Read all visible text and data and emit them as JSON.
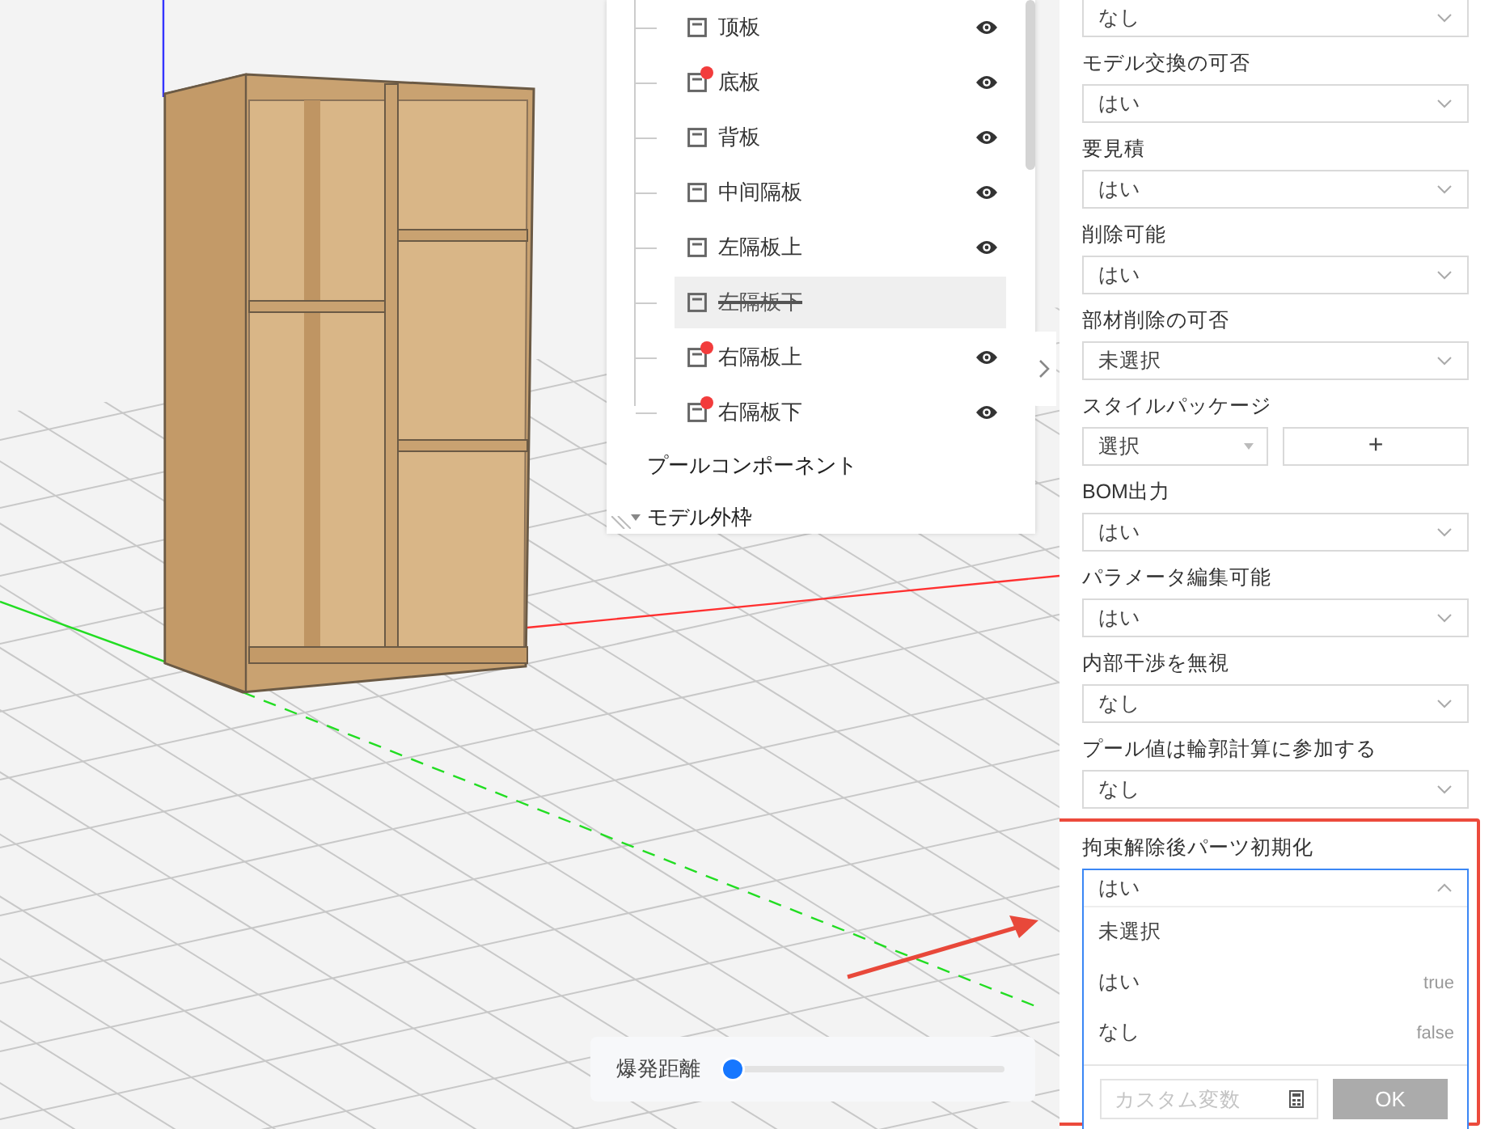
{
  "tree": {
    "items": [
      {
        "label": "顶板",
        "warning": false,
        "hidden": false,
        "selected": false
      },
      {
        "label": "底板",
        "warning": true,
        "hidden": false,
        "selected": false
      },
      {
        "label": "背板",
        "warning": false,
        "hidden": false,
        "selected": false
      },
      {
        "label": "中间隔板",
        "warning": false,
        "hidden": false,
        "selected": false
      },
      {
        "label": "左隔板上",
        "warning": false,
        "hidden": false,
        "selected": false
      },
      {
        "label": "左隔板下",
        "warning": false,
        "hidden": true,
        "selected": true
      },
      {
        "label": "右隔板上",
        "warning": true,
        "hidden": false,
        "selected": false
      },
      {
        "label": "右隔板下",
        "warning": true,
        "hidden": false,
        "selected": false
      }
    ],
    "groups": [
      {
        "label": "プールコンポーネント",
        "kind": "leaf"
      },
      {
        "label": "モデル外枠",
        "kind": "folder",
        "expanded": true
      }
    ]
  },
  "slider": {
    "label": "爆発距離",
    "level": 0
  },
  "properties": {
    "fields": [
      {
        "kind": "select",
        "value": "なし"
      },
      {
        "kind": "select",
        "label": "モデル交換の可否",
        "value": "はい"
      },
      {
        "kind": "select",
        "label": "要見積",
        "value": "はい"
      },
      {
        "kind": "select",
        "label": "削除可能",
        "value": "はい"
      },
      {
        "kind": "select",
        "label": "部材削除の可否",
        "value": "未選択"
      },
      {
        "kind": "select-add",
        "label": "スタイルパッケージ",
        "value": "選択",
        "button": "+"
      },
      {
        "kind": "select",
        "label": "BOM出力",
        "value": "はい"
      },
      {
        "kind": "select",
        "label": "パラメータ編集可能",
        "value": "はい"
      },
      {
        "kind": "select",
        "label": "内部干渉を無視",
        "value": "なし"
      },
      {
        "kind": "select",
        "label": "プール値は輪郭計算に参加する",
        "value": "なし"
      },
      {
        "kind": "dropdown-open",
        "label": "拘束解除後パーツ初期化",
        "value": "はい",
        "highlighted": true,
        "options": [
          {
            "label": "未選択"
          },
          {
            "label": "はい",
            "hint": "true"
          },
          {
            "label": "なし",
            "hint": "false"
          }
        ],
        "custom": {
          "placeholder": "カスタム変数"
        },
        "ok": {
          "label": "OK",
          "disabled": true
        }
      }
    ]
  }
}
